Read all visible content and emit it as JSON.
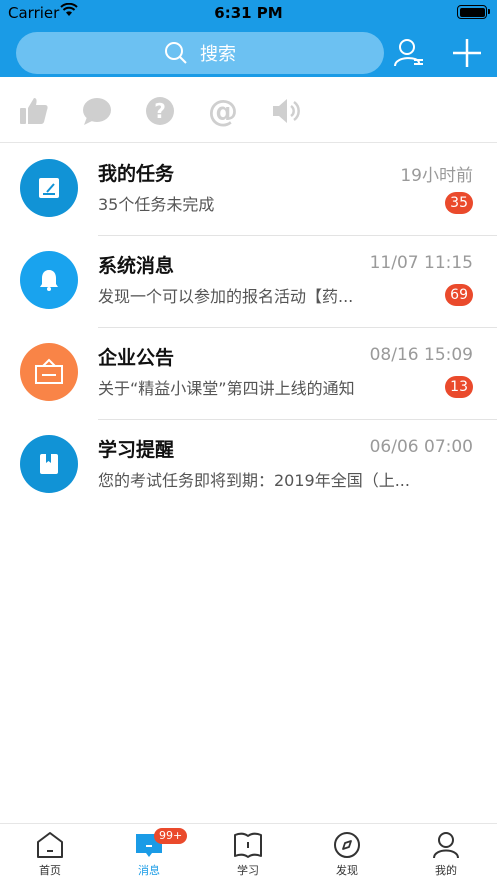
{
  "status_bar": {
    "carrier": "Carrier",
    "time": "6:31 PM"
  },
  "header": {
    "search_label": "搜索",
    "icons": [
      "contacts-icon",
      "plus-icon"
    ],
    "color": "#1a9be6"
  },
  "quick_actions": [
    "thumbs-up-icon",
    "comment-icon",
    "question-icon",
    "at-icon",
    "speaker-icon"
  ],
  "messages": [
    {
      "title": "我的任务",
      "time": "19小时前",
      "subtitle": "35个任务未完成",
      "badge": "35",
      "icon": "task-icon",
      "color": "#1193d6"
    },
    {
      "title": "系统消息",
      "time": "11/07 11:15",
      "subtitle": "发现一个可以参加的报名活动【药...",
      "badge": "69",
      "icon": "bell-icon",
      "color": "#19a3ee"
    },
    {
      "title": "企业公告",
      "time": "08/16 15:09",
      "subtitle": "关于“精益小课堂”第四讲上线的通知",
      "badge": "13",
      "icon": "announcement-icon",
      "color": "#f98447"
    },
    {
      "title": "学习提醒",
      "time": "06/06 07:00",
      "subtitle": "您的考试任务即将到期：2019年全国（上...",
      "badge": "",
      "icon": "book-icon",
      "color": "#1193d6"
    }
  ],
  "tabbar": {
    "active": "消息",
    "items": [
      {
        "label": "首页",
        "icon": "home-icon"
      },
      {
        "label": "消息",
        "icon": "message-icon",
        "badge": "99+"
      },
      {
        "label": "学习",
        "icon": "study-icon"
      },
      {
        "label": "发现",
        "icon": "compass-icon"
      },
      {
        "label": "我的",
        "icon": "profile-icon"
      }
    ]
  }
}
